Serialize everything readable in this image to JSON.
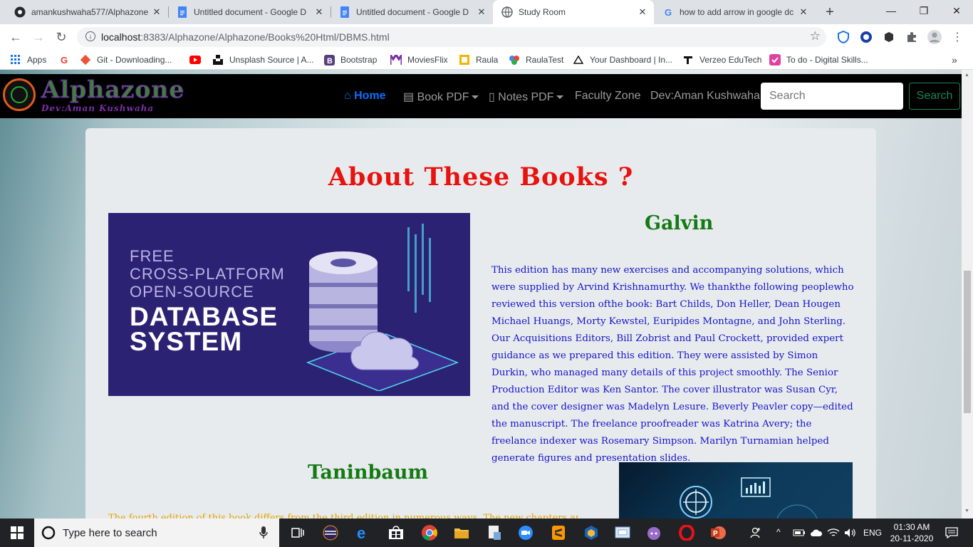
{
  "tabs": [
    {
      "title": "amankushwaha577/Alphazone"
    },
    {
      "title": "Untitled document - Google D"
    },
    {
      "title": "Untitled document - Google D"
    },
    {
      "title": "Study Room"
    },
    {
      "title": "how to add arrow in google dc"
    }
  ],
  "address": {
    "host": "localhost",
    "rest": ":8383/Alphazone/Alphazone/Books%20Html/DBMS.html"
  },
  "bookmarks": [
    "Apps",
    "Git - Downloading...",
    "Unsplash Source | A...",
    "Bootstrap",
    "MoviesFlix",
    "Raula",
    "RaulaTest",
    "Your Dashboard | In...",
    "Verzeo EduTech",
    "To do - Digital Skills..."
  ],
  "site": {
    "logo": "Alphazone",
    "logo_sub": "Dev:Aman Kushwaha",
    "nav": {
      "home": "Home",
      "book_pdf": "Book PDF",
      "notes_pdf": "Notes PDF",
      "faculty": "Faculty Zone",
      "dev": "Dev:Aman Kushwaha"
    },
    "search_placeholder": "Search",
    "search_button": "Search"
  },
  "content": {
    "heading": "About These Books ?",
    "image1": {
      "line1": "FREE",
      "line2": "CROSS-PLATFORM",
      "line3": "OPEN-SOURCE",
      "line4": "DATABASE",
      "line5": "SYSTEM"
    },
    "book1_title": "Galvin",
    "book1_desc": "This edition has many new exercises and accompanying solutions, which were supplied by Arvind Krishnamurthy. We thankthe following peoplewho reviewed this version ofthe book: Bart Childs, Don Heller, Dean Hougen Michael Huangs, Morty Kewstel, Euripides Montagne, and John Sterling. Our Acquisitions Editors, Bill Zobrist and Paul Crockett, provided expert guidance as we prepared this edition. They were assisted by Simon Durkin, who managed many details of this project smoothly. The Senior Production Editor was Ken Santor. The cover illustrator was Susan Cyr, and the cover designer was Madelyn Lesure. Beverly Peavler copy—edited the manuscript. The freelance proofreader was Katrina Avery; the freelance indexer was Rosemary Simpson. Marilyn Turnamian helped generate figures and presentation slides.",
    "book2_title": "Taninbaum",
    "book2_desc": "The fourth edition of this book differs from the third edition in numerous ways. The new chapters are given for all"
  },
  "taskbar": {
    "search_placeholder": "Type here to search",
    "lang": "ENG",
    "time": "01:30 AM",
    "date": "20-11-2020"
  },
  "colors": {
    "heading": "#e8130f",
    "book_title": "#157a14",
    "desc": "#1414c8",
    "accent": "#0d6efd",
    "search_btn": "#198754"
  }
}
